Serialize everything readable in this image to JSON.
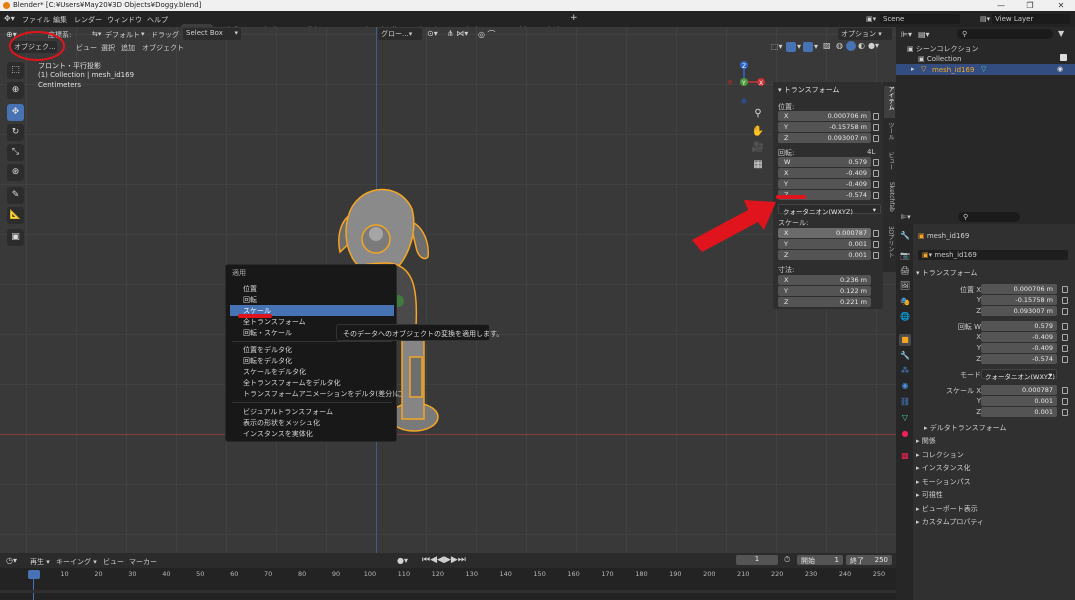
{
  "titlebar": {
    "title": "Blender* [C:¥Users¥May20¥3D Objects¥Doggy.blend]",
    "min": "—",
    "max": "❐",
    "close": "✕"
  },
  "menubar": {
    "menus": [
      "ファイル",
      "編集",
      "レンダー",
      "ウィンドウ",
      "ヘルプ"
    ],
    "workspaces": [
      "Layout",
      "Modeling",
      "Sculpting",
      "UV Editing",
      "Texture Paint",
      "Shading",
      "Animation",
      "Rendering",
      "Compositing",
      "Scripting"
    ],
    "add_workspace": "+",
    "scene": "Scene",
    "view_layer": "View Layer"
  },
  "viewport_header": {
    "mode": "オブジェク...",
    "orientation_label": "座標系:",
    "orientation": "デフォルト",
    "drag_label": "ドラッグ",
    "drag": "Select Box",
    "menus": [
      "ビュー",
      "選択",
      "追加",
      "オブジェクト"
    ],
    "transform_orientation": "グロー...",
    "options": "オプション"
  },
  "viewport_info": {
    "view": "フロント・平行投影",
    "collection": "(1) Collection | mesh_id169",
    "units": "Centimeters"
  },
  "gizmo": {
    "z": "Z",
    "y": "Y",
    "x": "X"
  },
  "npanel": {
    "section": "トランスフォーム",
    "location_label": "位置:",
    "location": [
      {
        "k": "X",
        "v": "0.000706 m"
      },
      {
        "k": "Y",
        "v": "-0.15758 m"
      },
      {
        "k": "Z",
        "v": "0.093007 m"
      }
    ],
    "rotation_label": "回転:",
    "rotation_mode_short": "4L",
    "rotation": [
      {
        "k": "W",
        "v": "0.579"
      },
      {
        "k": "X",
        "v": "-0.409"
      },
      {
        "k": "Y",
        "v": "-0.409"
      },
      {
        "k": "Z",
        "v": "-0.574"
      }
    ],
    "rotation_mode": "クォータニオン(WXYZ)",
    "scale_label": "スケール:",
    "scale": [
      {
        "k": "X",
        "v": "0.000787"
      },
      {
        "k": "Y",
        "v": "0.001"
      },
      {
        "k": "Z",
        "v": "0.001"
      }
    ],
    "dimensions_label": "寸法:",
    "dimensions": [
      {
        "k": "X",
        "v": "0.236 m"
      },
      {
        "k": "Y",
        "v": "0.122 m"
      },
      {
        "k": "Z",
        "v": "0.221 m"
      }
    ],
    "tabs": [
      "アイテム",
      "ツール",
      "ビュー",
      "Sketchfab",
      "3Dプリント"
    ]
  },
  "context_menu": {
    "title": "適用",
    "items": [
      "位置",
      "回転",
      "スケール",
      "全トランスフォーム",
      "回転・スケール",
      "位置をデルタ化",
      "回転をデルタ化",
      "スケールをデルタ化",
      "全トランスフォームをデルタ化",
      "トランスフォームアニメーションをデルタ(差分)に",
      "ビジュアルトランスフォーム",
      "表示の形状をメッシュ化",
      "インスタンスを実体化"
    ],
    "highlighted": "スケール"
  },
  "tooltip": {
    "text": "そのデータへのオブジェクトの変換を適用します。"
  },
  "outliner": {
    "root": "シーンコレクション",
    "collection": "Collection",
    "object": "mesh_id169"
  },
  "properties": {
    "object_name": "mesh_id169",
    "data_name": "mesh_id169",
    "section": "トランスフォーム",
    "location_label": "位置 X",
    "location": [
      "0.000706 m",
      "-0.15758 m",
      "0.093007 m"
    ],
    "rotation_label": "回転 W",
    "rotation": [
      "0.579",
      "-0.409",
      "-0.409",
      "-0.574"
    ],
    "mode_label": "モード",
    "mode": "クォータニオン(WXYZ)",
    "scale_label": "スケール X",
    "scale": [
      "0.000787",
      "0.001",
      "0.001"
    ],
    "axis_labels": [
      "X",
      "Y",
      "Z",
      "W"
    ],
    "subsections": [
      "デルタトランスフォーム",
      "関係",
      "コレクション",
      "インスタンス化",
      "モーションパス",
      "可視性",
      "ビューポート表示",
      "カスタムプロパティ"
    ]
  },
  "timeline": {
    "playback": "再生",
    "keying": "キーイング",
    "view": "ビュー",
    "marker": "マーカー",
    "current_frame": "1",
    "start_label": "開始",
    "start": "1",
    "end_label": "終了",
    "end": "250",
    "ticks": [
      "1",
      "10",
      "20",
      "30",
      "40",
      "50",
      "60",
      "70",
      "80",
      "90",
      "100",
      "110",
      "120",
      "130",
      "140",
      "150",
      "160",
      "170",
      "180",
      "190",
      "200",
      "210",
      "220",
      "230",
      "240",
      "250"
    ]
  },
  "colors": {
    "accent": "#4772b3",
    "annotation": "#e0141c",
    "selection": "#f5a623"
  }
}
